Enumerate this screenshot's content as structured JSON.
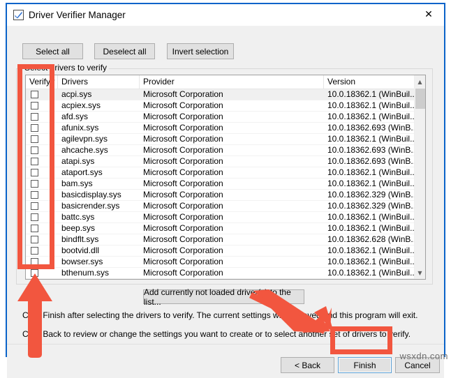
{
  "window": {
    "title": "Driver Verifier Manager",
    "icon": "checkbox-check-icon",
    "close_label": "✕",
    "border_color": "#0a63c9"
  },
  "toolbar": {
    "select_all": "Select all",
    "deselect_all": "Deselect all",
    "invert_selection": "Invert selection"
  },
  "group": {
    "label": "Select drivers to verify"
  },
  "list": {
    "columns": [
      "Verify?",
      "Drivers",
      "Provider",
      "Version"
    ],
    "scrollbar": {
      "up": "▲",
      "down": "▼"
    },
    "rows": [
      {
        "verify": false,
        "driver": "acpi.sys",
        "provider": "Microsoft Corporation",
        "version": "10.0.18362.1 (WinBuil..."
      },
      {
        "verify": false,
        "driver": "acpiex.sys",
        "provider": "Microsoft Corporation",
        "version": "10.0.18362.1 (WinBuil..."
      },
      {
        "verify": false,
        "driver": "afd.sys",
        "provider": "Microsoft Corporation",
        "version": "10.0.18362.1 (WinBuil..."
      },
      {
        "verify": false,
        "driver": "afunix.sys",
        "provider": "Microsoft Corporation",
        "version": "10.0.18362.693 (WinB..."
      },
      {
        "verify": false,
        "driver": "agilevpn.sys",
        "provider": "Microsoft Corporation",
        "version": "10.0.18362.1 (WinBuil..."
      },
      {
        "verify": false,
        "driver": "ahcache.sys",
        "provider": "Microsoft Corporation",
        "version": "10.0.18362.693 (WinB..."
      },
      {
        "verify": false,
        "driver": "atapi.sys",
        "provider": "Microsoft Corporation",
        "version": "10.0.18362.693 (WinB..."
      },
      {
        "verify": false,
        "driver": "ataport.sys",
        "provider": "Microsoft Corporation",
        "version": "10.0.18362.1 (WinBuil..."
      },
      {
        "verify": false,
        "driver": "bam.sys",
        "provider": "Microsoft Corporation",
        "version": "10.0.18362.1 (WinBuil..."
      },
      {
        "verify": false,
        "driver": "basicdisplay.sys",
        "provider": "Microsoft Corporation",
        "version": "10.0.18362.329 (WinB..."
      },
      {
        "verify": false,
        "driver": "basicrender.sys",
        "provider": "Microsoft Corporation",
        "version": "10.0.18362.329 (WinB..."
      },
      {
        "verify": false,
        "driver": "battc.sys",
        "provider": "Microsoft Corporation",
        "version": "10.0.18362.1 (WinBuil..."
      },
      {
        "verify": false,
        "driver": "beep.sys",
        "provider": "Microsoft Corporation",
        "version": "10.0.18362.1 (WinBuil..."
      },
      {
        "verify": false,
        "driver": "bindflt.sys",
        "provider": "Microsoft Corporation",
        "version": "10.0.18362.628 (WinB..."
      },
      {
        "verify": false,
        "driver": "bootvid.dll",
        "provider": "Microsoft Corporation",
        "version": "10.0.18362.1 (WinBuil..."
      },
      {
        "verify": false,
        "driver": "bowser.sys",
        "provider": "Microsoft Corporation",
        "version": "10.0.18362.1 (WinBuil..."
      },
      {
        "verify": false,
        "driver": "bthenum.sys",
        "provider": "Microsoft Corporation",
        "version": "10.0.18362.1 (WinBuil..."
      }
    ]
  },
  "add_driver": {
    "label": "Add currently not loaded driver(s) to the list..."
  },
  "instructions": {
    "line1": "Click Finish after selecting the drivers to verify. The current settings will be saved and this program will exit.",
    "line2": "Click Back to review or change the settings you want to create or to select another set of drivers to verify."
  },
  "footer": {
    "back": "< Back",
    "finish": "Finish",
    "cancel": "Cancel"
  },
  "annotations": {
    "color": "#f2563f",
    "highlight_verify_column": "rectangle",
    "highlight_finish_button": "rectangle",
    "arrow_up": "arrow-up-icon",
    "arrow_diagonal": "arrow-down-right-icon"
  },
  "watermark": {
    "text": "wsxdn.com"
  }
}
